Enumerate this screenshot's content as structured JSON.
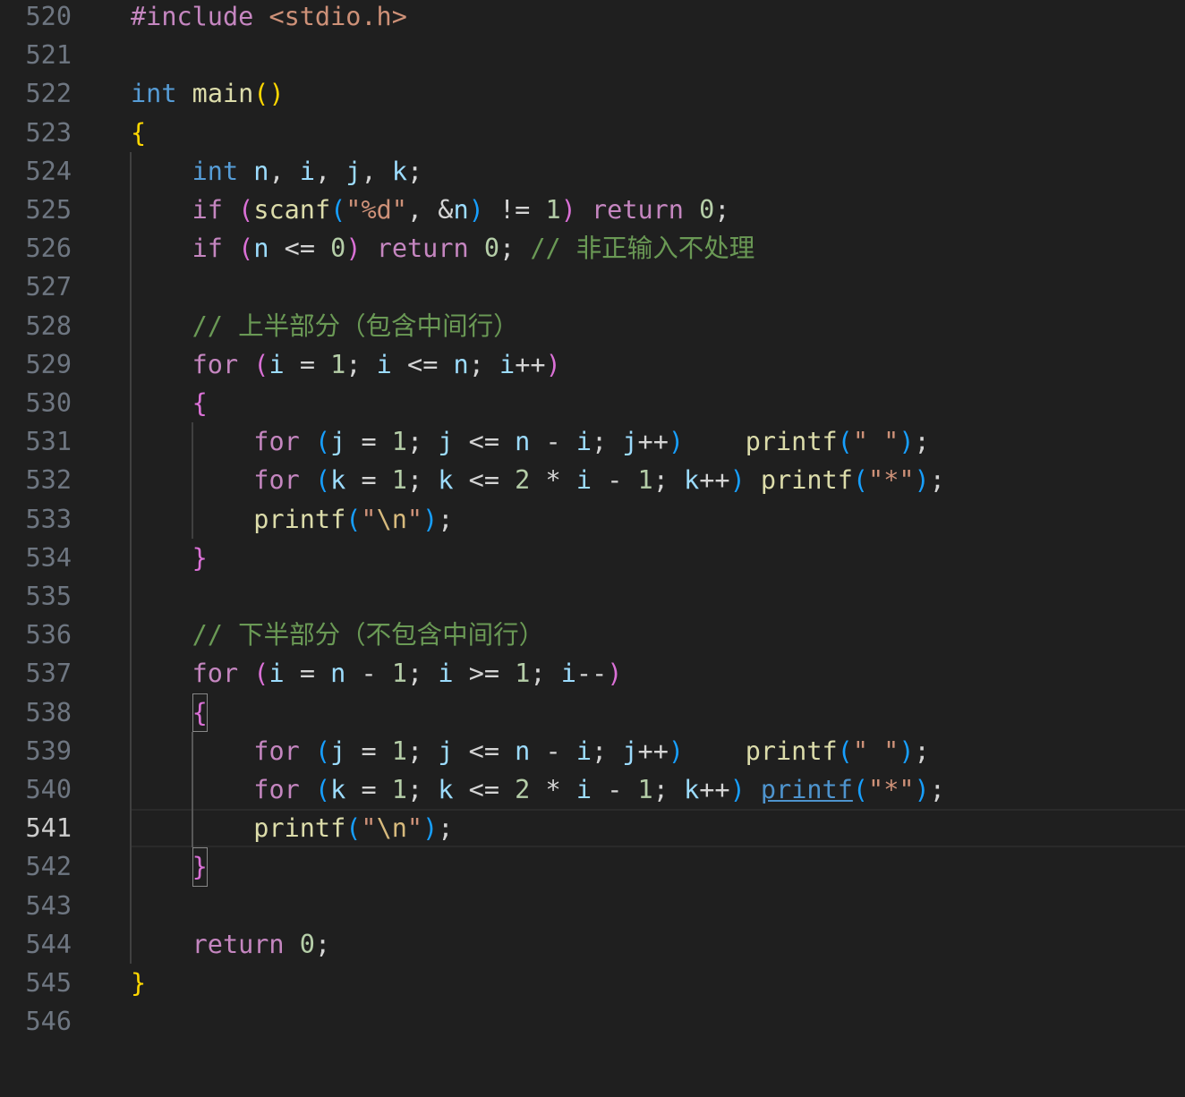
{
  "editor": {
    "language": "c",
    "current_line": 541,
    "colors": {
      "background": "#1f1f1f",
      "line_number": "#6e7681",
      "line_number_active": "#cccccc",
      "keyword_control": "#c586c0",
      "keyword_type": "#569cd6",
      "function": "#dcdcaa",
      "variable": "#9cdcfe",
      "number": "#b5cea8",
      "string": "#ce9178",
      "comment": "#6a9955",
      "bracket_level1": "#ffd700",
      "bracket_level2": "#da70d6",
      "bracket_level3": "#179fff"
    },
    "lines": [
      {
        "n": 520,
        "text": "#include <stdio.h>"
      },
      {
        "n": 521,
        "text": ""
      },
      {
        "n": 522,
        "text": "int main()"
      },
      {
        "n": 523,
        "text": "{"
      },
      {
        "n": 524,
        "text": "    int n, i, j, k;"
      },
      {
        "n": 525,
        "text": "    if (scanf(\"%d\", &n) != 1) return 0;"
      },
      {
        "n": 526,
        "text": "    if (n <= 0) return 0; // 非正输入不处理"
      },
      {
        "n": 527,
        "text": ""
      },
      {
        "n": 528,
        "text": "    // 上半部分（包含中间行）"
      },
      {
        "n": 529,
        "text": "    for (i = 1; i <= n; i++)"
      },
      {
        "n": 530,
        "text": "    {"
      },
      {
        "n": 531,
        "text": "        for (j = 1; j <= n - i; j++)    printf(\" \");"
      },
      {
        "n": 532,
        "text": "        for (k = 1; k <= 2 * i - 1; k++) printf(\"*\");"
      },
      {
        "n": 533,
        "text": "        printf(\"\\n\");"
      },
      {
        "n": 534,
        "text": "    }"
      },
      {
        "n": 535,
        "text": ""
      },
      {
        "n": 536,
        "text": "    // 下半部分（不包含中间行）"
      },
      {
        "n": 537,
        "text": "    for (i = n - 1; i >= 1; i--)"
      },
      {
        "n": 538,
        "text": "    {"
      },
      {
        "n": 539,
        "text": "        for (j = 1; j <= n - i; j++)    printf(\" \");"
      },
      {
        "n": 540,
        "text": "        for (k = 1; k <= 2 * i - 1; k++) printf(\"*\");"
      },
      {
        "n": 541,
        "text": "        printf(\"\\n\");"
      },
      {
        "n": 542,
        "text": "    }"
      },
      {
        "n": 543,
        "text": ""
      },
      {
        "n": 544,
        "text": "    return 0;"
      },
      {
        "n": 545,
        "text": "}"
      },
      {
        "n": 546,
        "text": ""
      }
    ]
  }
}
